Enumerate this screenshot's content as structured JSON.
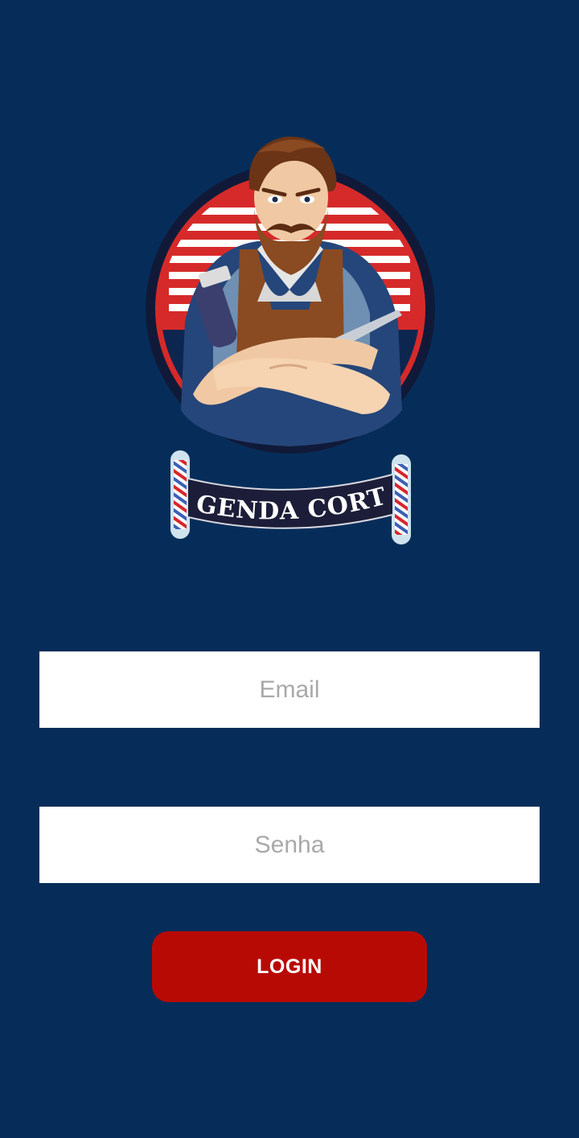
{
  "logo": {
    "brand_text": "AGENDA CORTE",
    "icon": "barber-mascot-logo"
  },
  "form": {
    "email_placeholder": "Email",
    "password_placeholder": "Senha",
    "login_label": "LOGIN"
  },
  "colors": {
    "background": "#062d59",
    "button": "#b80a05",
    "input_background": "#ffffff",
    "placeholder": "#a9a9a9"
  }
}
